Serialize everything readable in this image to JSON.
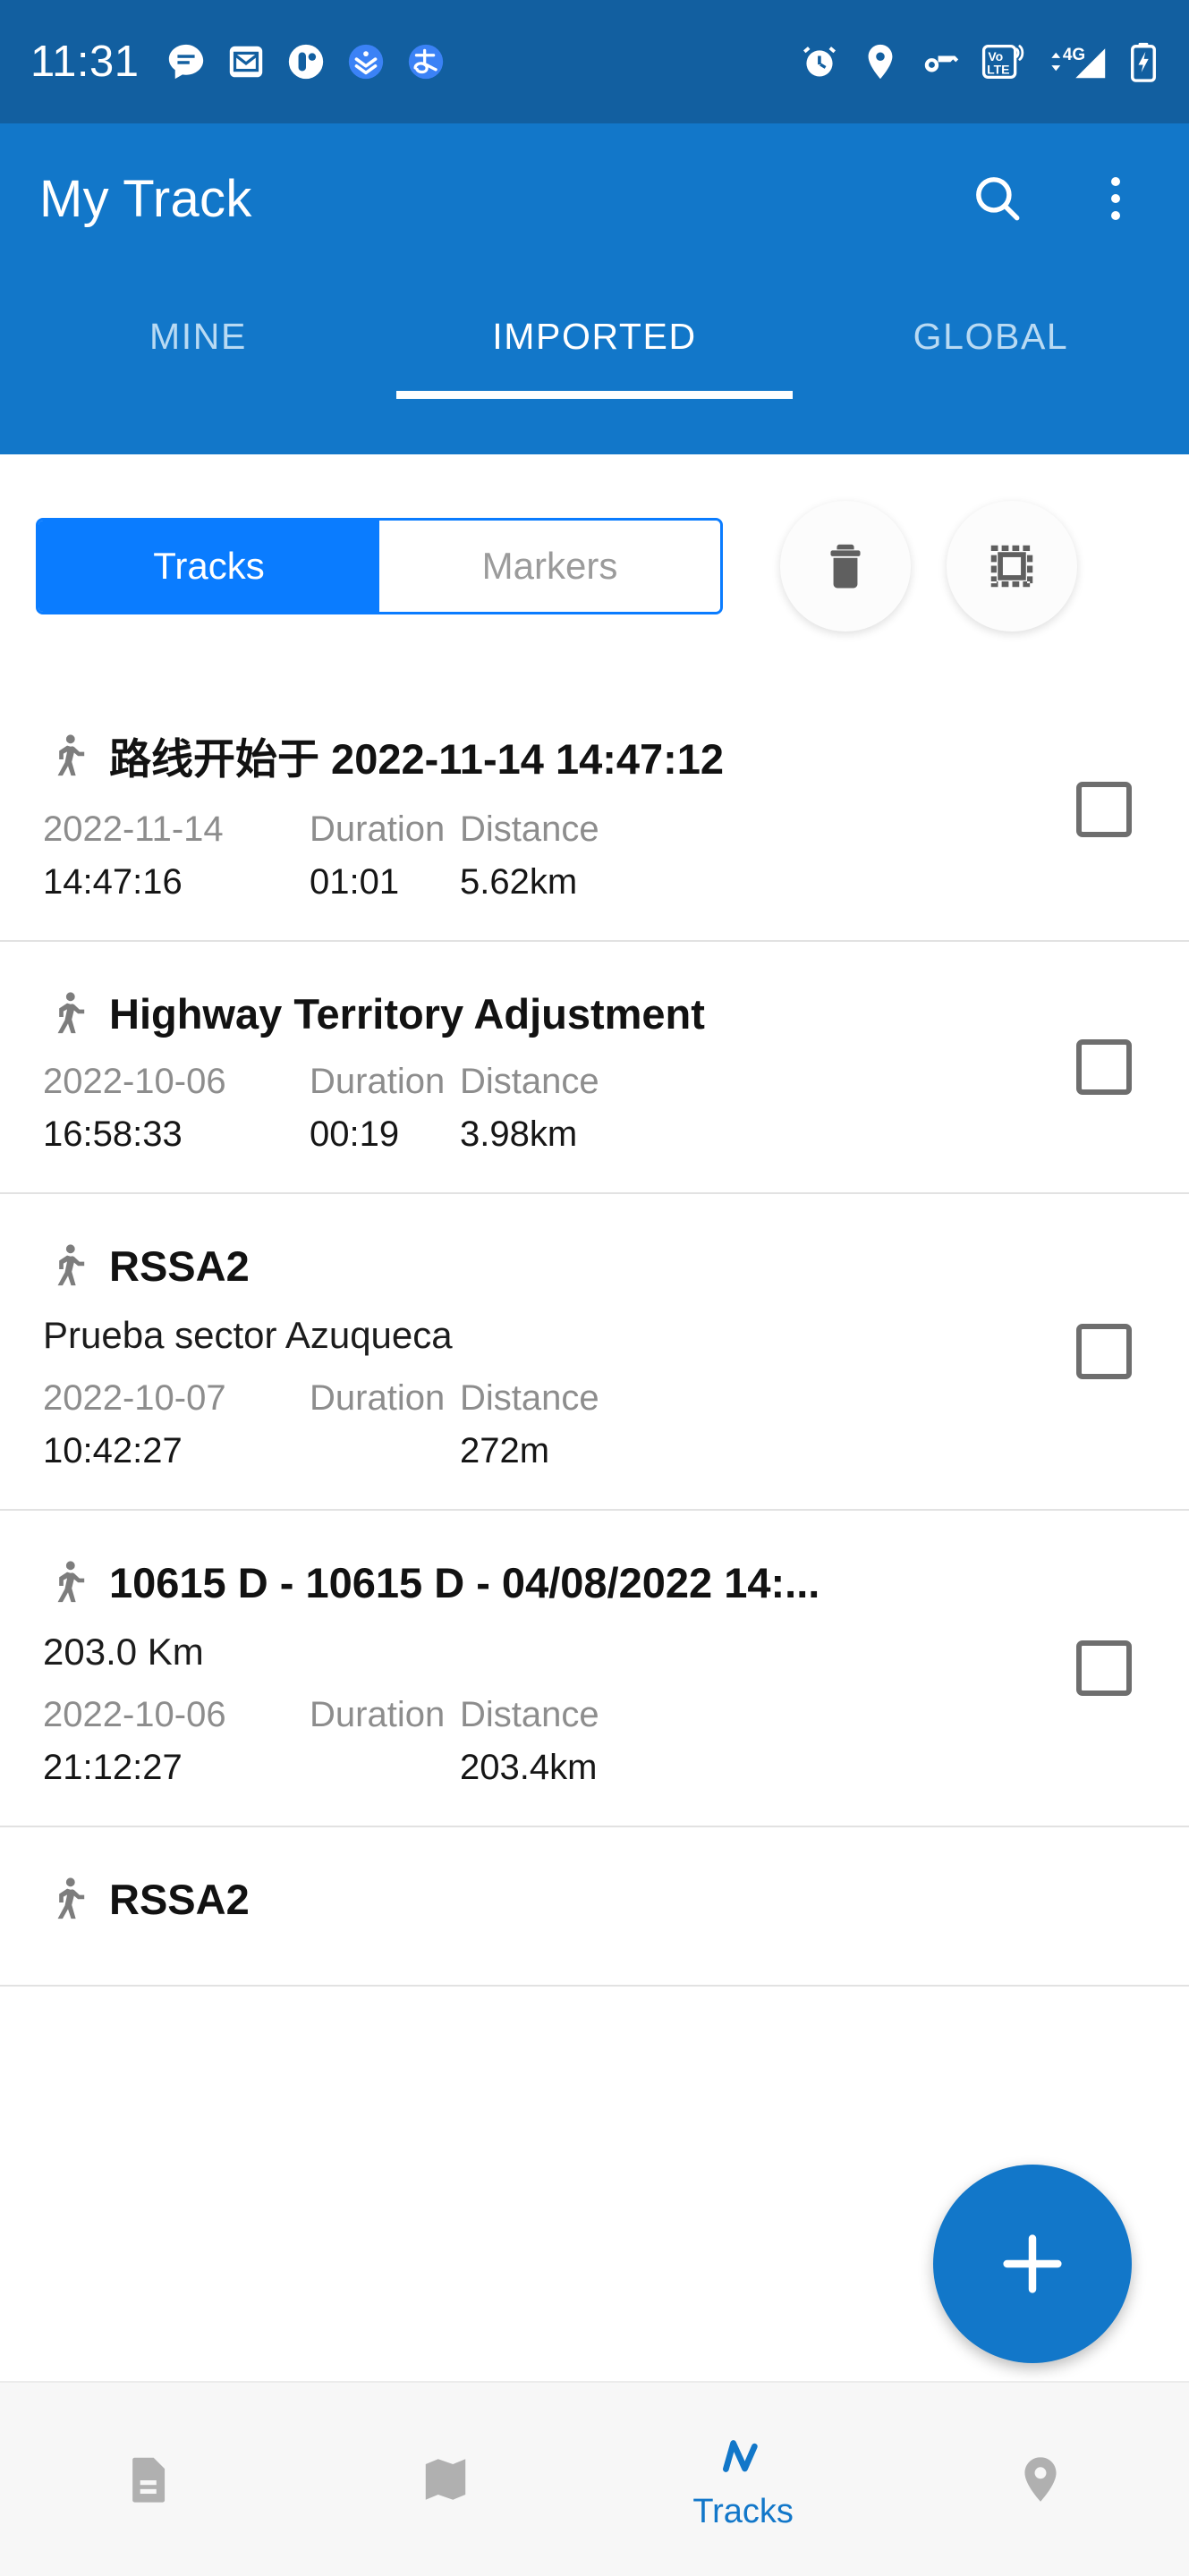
{
  "status_bar": {
    "time": "11:31",
    "left_icons": [
      "chat-bubble-icon",
      "email-icon",
      "contacts-icon",
      "download-manager-icon",
      "alipay-icon"
    ],
    "right_icons": [
      "alarm-icon",
      "location-icon",
      "vpn-key-icon",
      "volte-icon",
      "signal-4g-icon",
      "battery-charging-icon"
    ],
    "network_label": "4G",
    "volte_label_top": "Vo",
    "volte_label_bottom": "LTE"
  },
  "app_bar": {
    "title": "My Track",
    "search_icon": "search-icon",
    "overflow_icon": "more-vertical-icon",
    "tabs": [
      {
        "label": "MINE",
        "active": false
      },
      {
        "label": "IMPORTED",
        "active": true
      },
      {
        "label": "GLOBAL",
        "active": false
      }
    ]
  },
  "controls": {
    "segmented": [
      {
        "label": "Tracks",
        "active": true
      },
      {
        "label": "Markers",
        "active": false
      }
    ],
    "delete_icon": "trash-icon",
    "select_all_icon": "select-all-icon",
    "accent_color": "#0a7cff"
  },
  "list": {
    "labels": {
      "duration": "Duration",
      "distance": "Distance"
    },
    "items": [
      {
        "icon": "walking-person-icon",
        "title": "路线开始于 2022-11-14 14:47:12",
        "description": "",
        "date": "2022-11-14",
        "time": "14:47:16",
        "duration": "01:01",
        "distance": "5.62km"
      },
      {
        "icon": "walking-person-icon",
        "title": "Highway Territory Adjustment",
        "description": "",
        "date": "2022-10-06",
        "time": "16:58:33",
        "duration": "00:19",
        "distance": "3.98km"
      },
      {
        "icon": "walking-person-icon",
        "title": "RSSA2",
        "description": "Prueba sector Azuqueca",
        "date": "2022-10-07",
        "time": "10:42:27",
        "duration": "",
        "distance": "272m"
      },
      {
        "icon": "walking-person-icon",
        "title": "10615 D - 10615 D - 04/08/2022 14:...",
        "description": "203.0 Km",
        "date": "2022-10-06",
        "time": "21:12:27",
        "duration": "",
        "distance": "203.4km"
      },
      {
        "icon": "walking-person-icon",
        "title": "RSSA2",
        "description": "",
        "date": "",
        "time": "",
        "duration": "",
        "distance": ""
      }
    ]
  },
  "fab": {
    "icon": "plus-icon",
    "color": "#1277c9"
  },
  "bottom_nav": {
    "items": [
      {
        "icon": "document-icon",
        "label": "",
        "active": false
      },
      {
        "icon": "map-icon",
        "label": "",
        "active": false
      },
      {
        "icon": "tracks-icon",
        "label": "Tracks",
        "active": true
      },
      {
        "icon": "location-pin-icon",
        "label": "",
        "active": false
      }
    ],
    "active_color": "#1277c9"
  }
}
